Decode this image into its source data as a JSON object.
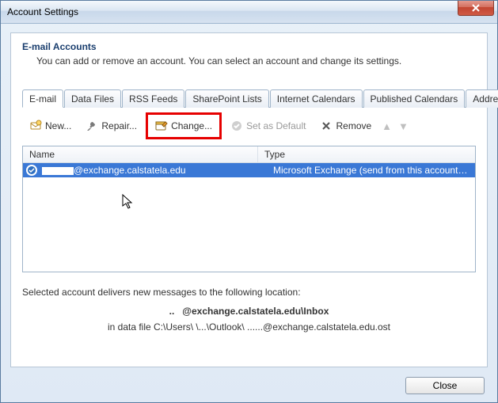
{
  "window": {
    "title": "Account Settings"
  },
  "section": {
    "title": "E-mail Accounts",
    "desc": "You can add or remove an account. You can select an account and change its settings."
  },
  "tabs": [
    {
      "label": "E-mail",
      "active": true
    },
    {
      "label": "Data Files"
    },
    {
      "label": "RSS Feeds"
    },
    {
      "label": "SharePoint Lists"
    },
    {
      "label": "Internet Calendars"
    },
    {
      "label": "Published Calendars"
    },
    {
      "label": "Address Books"
    }
  ],
  "toolbar": {
    "new": "New...",
    "repair": "Repair...",
    "change": "Change...",
    "set_default": "Set as Default",
    "remove": "Remove"
  },
  "list": {
    "col_name": "Name",
    "col_type": "Type",
    "rows": [
      {
        "name": "@exchange.calstatela.edu",
        "type": "Microsoft Exchange (send from this account by def..."
      }
    ]
  },
  "location": {
    "intro": "Selected account delivers new messages to the following location:",
    "line1": "@exchange.calstatela.edu\\Inbox",
    "line2": "in data file C:\\Users\\      \\...\\Outlook\\   ......@exchange.calstatela.edu.ost"
  },
  "footer": {
    "close": "Close"
  }
}
